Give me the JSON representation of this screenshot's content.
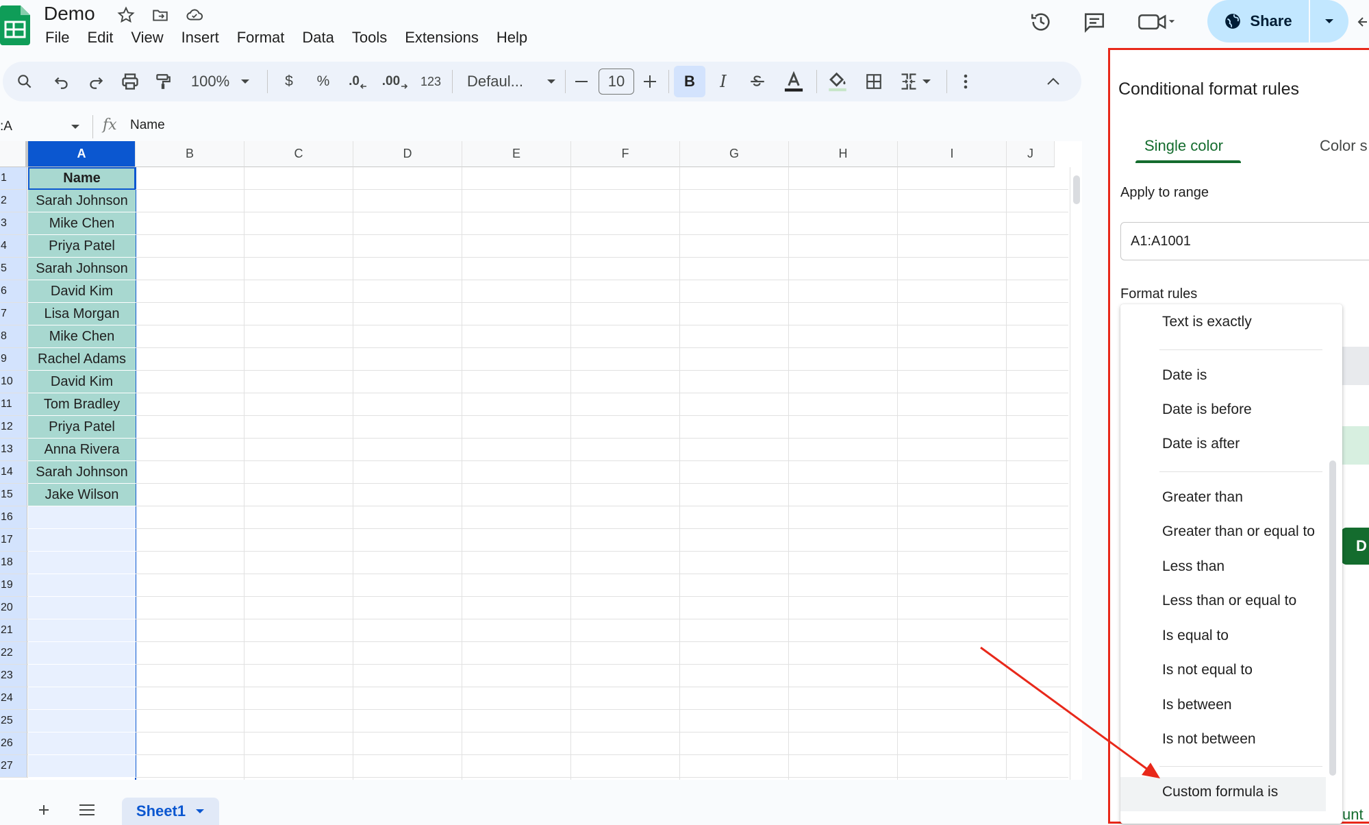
{
  "app": {
    "doc_title": "Demo",
    "menu": [
      "File",
      "Edit",
      "View",
      "Insert",
      "Format",
      "Data",
      "Tools",
      "Extensions",
      "Help"
    ],
    "share_label": "Share"
  },
  "toolbar": {
    "zoom": "100%",
    "currency": "$",
    "percent": "%",
    "decrease_decimal": ".0",
    "increase_decimal": ".00",
    "number_format": "123",
    "font": "Defaul...",
    "font_size": "10",
    "bold": "B",
    "italic": "I"
  },
  "formula_bar": {
    "name_box": ":A",
    "fx": "fx",
    "value": "Name"
  },
  "grid": {
    "columns": [
      "A",
      "B",
      "C",
      "D",
      "E",
      "F",
      "G",
      "H",
      "I",
      "J"
    ],
    "rows": [
      "1",
      "2",
      "3",
      "4",
      "5",
      "6",
      "7",
      "8",
      "9",
      "10",
      "11",
      "12",
      "13",
      "14",
      "15",
      "16",
      "17",
      "18",
      "19",
      "20",
      "21",
      "22",
      "23",
      "24",
      "25",
      "26",
      "27"
    ],
    "column_a": [
      "Name",
      "Sarah Johnson",
      "Mike Chen",
      "Priya Patel",
      "Sarah Johnson",
      "David Kim",
      "Lisa Morgan",
      "Mike Chen",
      "Rachel Adams",
      "David Kim",
      "Tom Bradley",
      "Priya Patel",
      "Anna Rivera",
      "Sarah Johnson",
      "Jake Wilson"
    ]
  },
  "sheets": {
    "active": "Sheet1"
  },
  "panel": {
    "title": "Conditional format rules",
    "tab_single": "Single color",
    "tab_color": "Color s",
    "apply_label": "Apply to range",
    "range_value": "A1:A1001",
    "format_rules_label": "Format rules",
    "green_button_partial": "D",
    "bottom_partial": "unt"
  },
  "dropdown": {
    "options": [
      "Text is exactly",
      "Date is",
      "Date is before",
      "Date is after",
      "Greater than",
      "Greater than or equal to",
      "Less than",
      "Less than or equal to",
      "Is equal to",
      "Is not equal to",
      "Is between",
      "Is not between",
      "Custom formula is"
    ],
    "highlighted": "Custom formula is"
  },
  "colors": {
    "accent_blue": "#0b57d0",
    "selected_col_fill": "#a8d8d0",
    "annotation_red": "#e8281a",
    "green": "#146c2e"
  }
}
